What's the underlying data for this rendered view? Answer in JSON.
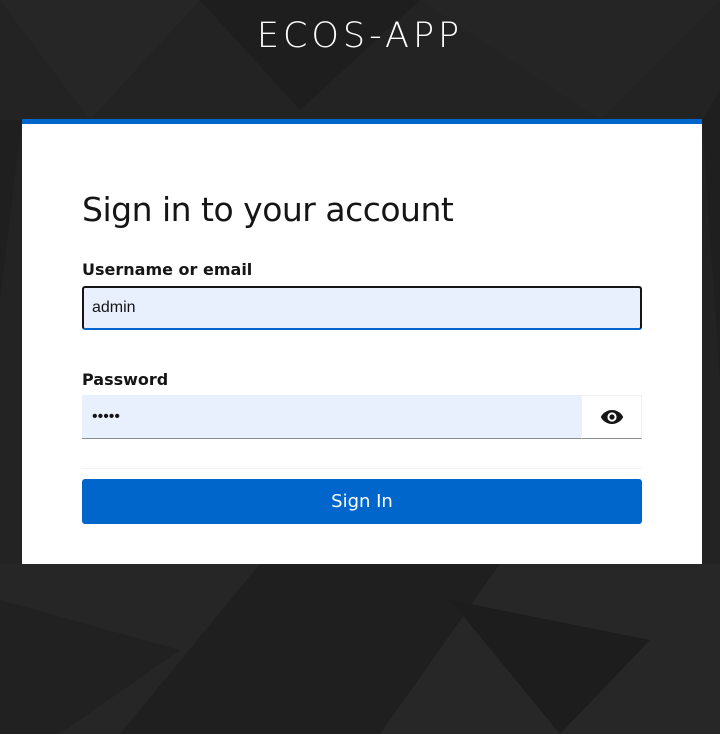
{
  "app": {
    "title": "ECOS-APP"
  },
  "login": {
    "heading": "Sign in to your account",
    "username": {
      "label": "Username or email",
      "value": "admin"
    },
    "password": {
      "label": "Password",
      "value": "admin"
    },
    "submit_label": "Sign In",
    "toggle_icon": "eye-icon"
  },
  "colors": {
    "background": "#222222",
    "card": "#ffffff",
    "accent": "#0066cc",
    "input_fill": "#e8f0fe",
    "text": "#151515"
  }
}
